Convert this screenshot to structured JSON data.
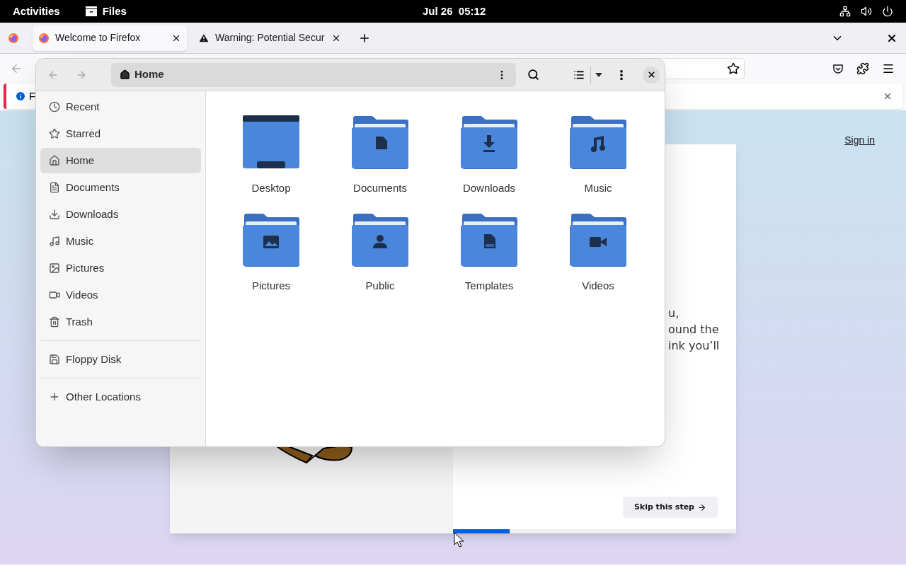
{
  "top_bar": {
    "activities": "Activities",
    "app_name": "Files",
    "clock": "Jul 26  05:12"
  },
  "browser": {
    "tabs": [
      {
        "title": "Welcome to Firefox",
        "kind": "firefox",
        "selected": true
      },
      {
        "title": "Warning: Potential Secur",
        "kind": "warning",
        "selected": false
      }
    ],
    "notification": {
      "text": "F"
    },
    "page": {
      "sign_in": "Sign in",
      "text_lines": [
        "u,",
        "ound the",
        "ink you’ll"
      ],
      "skip_button": "Skip this step",
      "progress": {
        "level": 0.2
      }
    }
  },
  "files": {
    "path": "Home",
    "sidebar": [
      {
        "label": "Recent",
        "kind": "recent",
        "selected": false
      },
      {
        "label": "Starred",
        "kind": "starred",
        "selected": false
      },
      {
        "label": "Home",
        "kind": "home",
        "selected": true
      },
      {
        "label": "Documents",
        "kind": "documents",
        "selected": false
      },
      {
        "label": "Downloads",
        "kind": "downloads",
        "selected": false
      },
      {
        "label": "Music",
        "kind": "music",
        "selected": false
      },
      {
        "label": "Pictures",
        "kind": "pictures",
        "selected": false
      },
      {
        "label": "Videos",
        "kind": "videos",
        "selected": false
      },
      {
        "label": "Trash",
        "kind": "trash",
        "selected": false
      }
    ],
    "devices": [
      {
        "label": "Floppy Disk",
        "kind": "floppy",
        "selected": false
      }
    ],
    "other": {
      "label": "Other Locations"
    },
    "folders": [
      {
        "name": "Desktop",
        "kind": "desktop"
      },
      {
        "name": "Documents",
        "kind": "documents"
      },
      {
        "name": "Downloads",
        "kind": "downloads"
      },
      {
        "name": "Music",
        "kind": "music"
      },
      {
        "name": "Pictures",
        "kind": "pictures"
      },
      {
        "name": "Public",
        "kind": "public"
      },
      {
        "name": "Templates",
        "kind": "templates"
      },
      {
        "name": "Videos",
        "kind": "videos"
      }
    ]
  }
}
